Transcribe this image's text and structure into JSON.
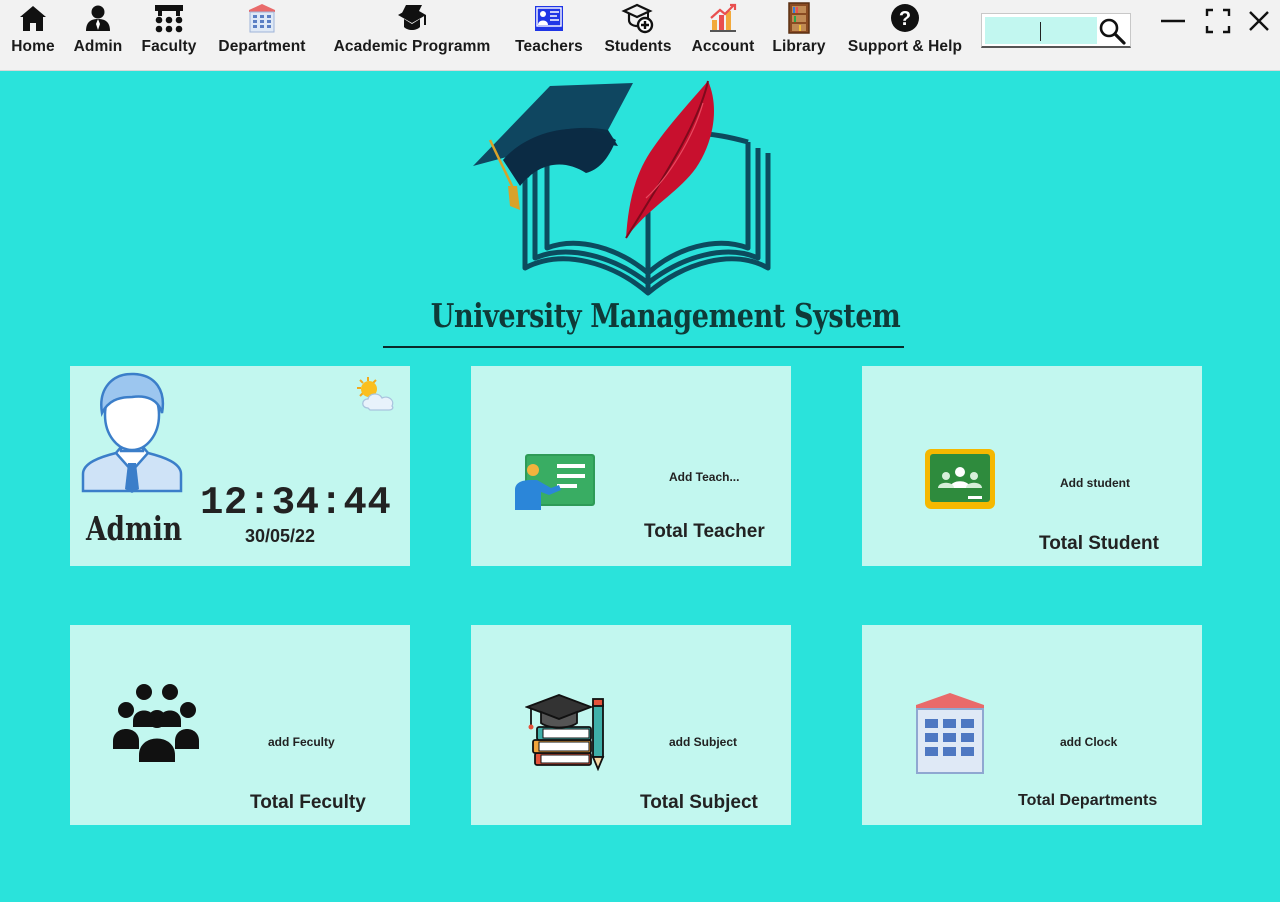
{
  "nav": {
    "items": [
      {
        "label": "Home",
        "icon": "home-icon"
      },
      {
        "label": "Admin",
        "icon": "admin-icon"
      },
      {
        "label": "Faculty",
        "icon": "faculty-icon"
      },
      {
        "label": "Department",
        "icon": "department-icon"
      },
      {
        "label": "Academic Programm",
        "icon": "academic-program-icon"
      },
      {
        "label": "Teachers",
        "icon": "teachers-icon"
      },
      {
        "label": "Students",
        "icon": "students-icon"
      },
      {
        "label": "Account",
        "icon": "account-icon"
      },
      {
        "label": "Library",
        "icon": "library-icon"
      },
      {
        "label": "Support & Help",
        "icon": "support-help-icon"
      }
    ]
  },
  "search": {
    "value": "",
    "icon": "search-icon"
  },
  "window_controls": {
    "minimize_icon": "minimize-icon",
    "maximize_icon": "maximize-icon",
    "close_icon": "close-icon"
  },
  "app": {
    "title": "University Management System",
    "logo_icon": "graduation-cap-book-quill-icon"
  },
  "admin_card": {
    "name": "Admin",
    "time": "12:34:44",
    "date": "30/05/22",
    "avatar_icon": "admin-avatar-icon",
    "weather_icon": "sun-cloud-icon"
  },
  "cards": {
    "teacher": {
      "add_label": "Add Teach...",
      "total_label": "Total Teacher",
      "icon": "teacher-board-icon"
    },
    "student": {
      "add_label": "Add student",
      "total_label": "Total Student",
      "icon": "classroom-icon"
    },
    "faculty": {
      "add_label": "add Feculty",
      "total_label": "Total Feculty",
      "icon": "group-people-icon"
    },
    "subject": {
      "add_label": "add Subject",
      "total_label": "Total Subject",
      "icon": "books-cap-pencil-icon"
    },
    "department": {
      "add_label": "add Clock",
      "total_label": "Total Departments",
      "icon": "building-icon"
    }
  },
  "colors": {
    "background": "#2ae3db",
    "card": "#c2f7ef",
    "topbar": "#f2f2f2",
    "title": "#0f3a38"
  }
}
